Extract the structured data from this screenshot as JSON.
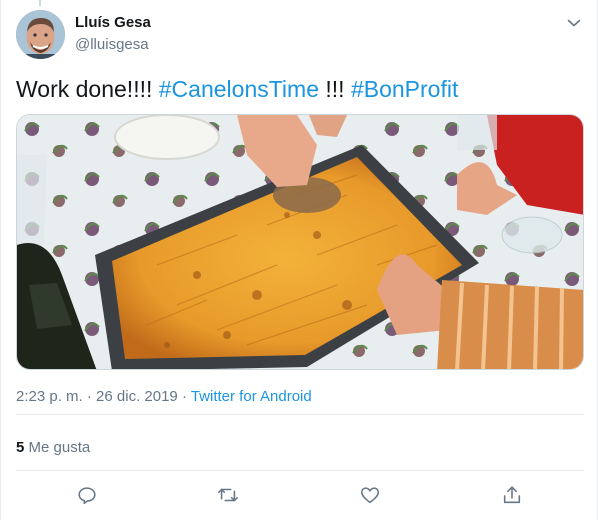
{
  "user": {
    "name": "Lluís Gesa",
    "handle": "@lluisgesa"
  },
  "tweet": {
    "text_plain_1": "Work done!!!! ",
    "hashtag_1": "#CanelonsTime",
    "text_plain_2": " !!! ",
    "hashtag_2": "#BonProfit"
  },
  "meta": {
    "time": "2:23 p. m.",
    "separator_1": " · ",
    "date": "26 dic. 2019",
    "separator_2": " · ",
    "source": "Twitter for Android"
  },
  "stats": {
    "likes_count": "5",
    "likes_label": " Me gusta"
  },
  "icons": {
    "reply": "reply-icon",
    "retweet": "retweet-icon",
    "like": "heart-icon",
    "share": "share-icon",
    "caret": "chevron-down-icon"
  },
  "colors": {
    "link": "#1b95e0",
    "secondary_text": "#657786",
    "divider": "#e6ecf0"
  }
}
